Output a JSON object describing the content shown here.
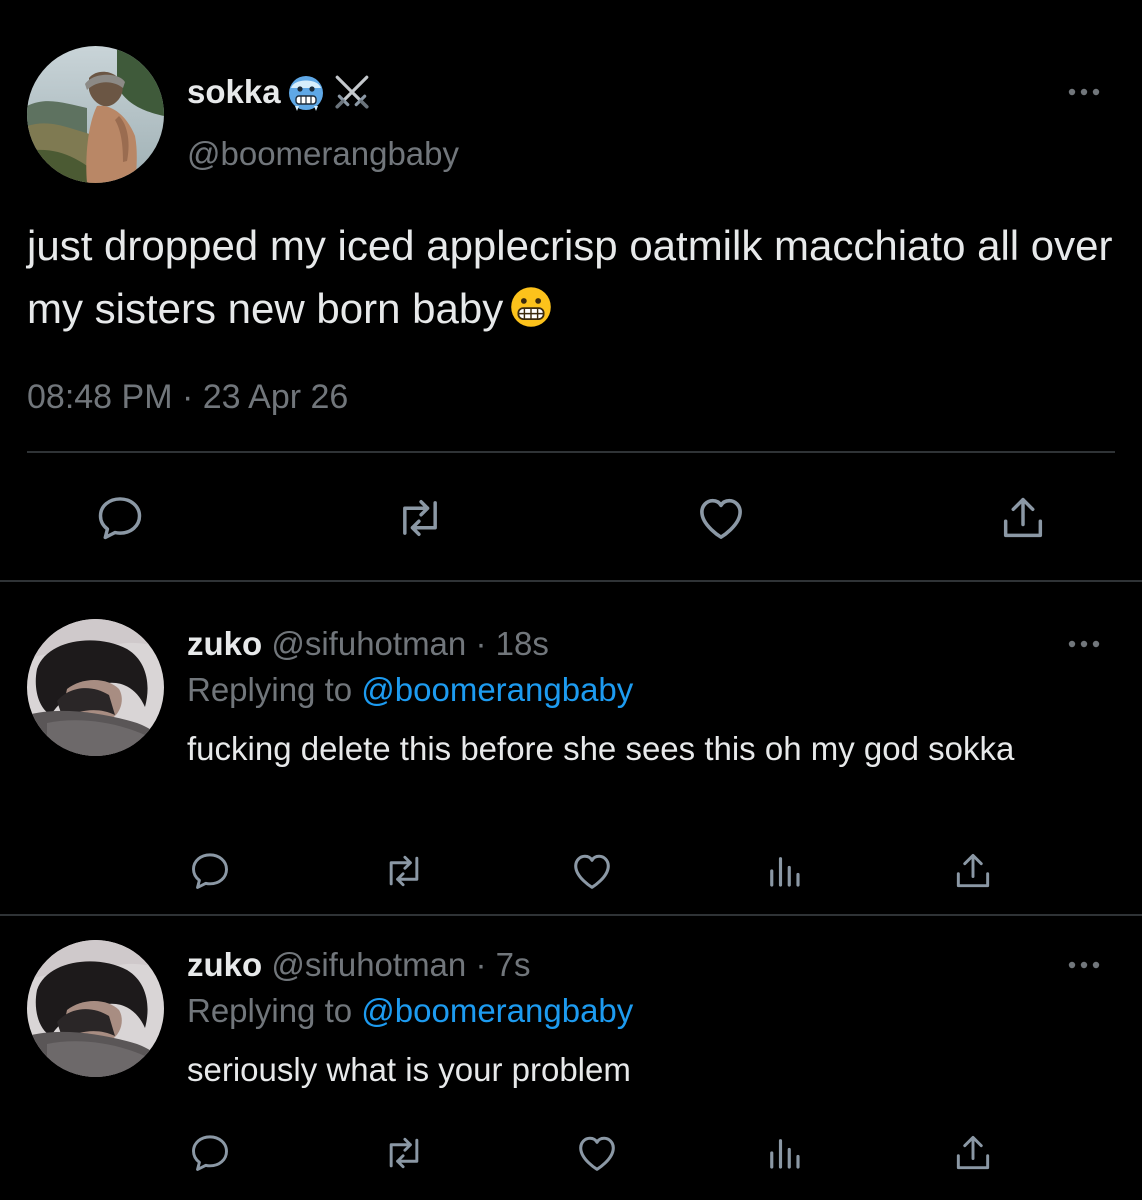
{
  "main_tweet": {
    "display_name": "sokka",
    "handle": "@boomerangbaby",
    "text": "just dropped my iced applecrisp oatmilk macchiato all over my sisters new born baby",
    "time": "08:48 PM",
    "separator": "·",
    "date": "23 Apr 26",
    "icons": [
      "cold-face-emoji",
      "crossed-swords-icon",
      "grimacing-face-emoji",
      "more-icon",
      "reply-icon",
      "retweet-icon",
      "like-icon",
      "share-icon"
    ]
  },
  "replies": [
    {
      "display_name": "zuko",
      "handle": "@sifuhotman",
      "time": "· 18s",
      "replying_prefix": "Replying to",
      "replying_to": "@boomerangbaby",
      "text": "fucking delete this before she sees this oh my god sokka"
    },
    {
      "display_name": "zuko",
      "handle": "@sifuhotman",
      "time": "· 7s",
      "replying_prefix": "Replying to",
      "replying_to": "@boomerangbaby",
      "text": "seriously what is your problem"
    }
  ],
  "colors": {
    "background": "#000000",
    "primary_text": "#e7e9ea",
    "secondary_text": "#71767b",
    "link": "#1d9bf0",
    "divider": "#2f3336",
    "icon": "#8b98a5"
  }
}
